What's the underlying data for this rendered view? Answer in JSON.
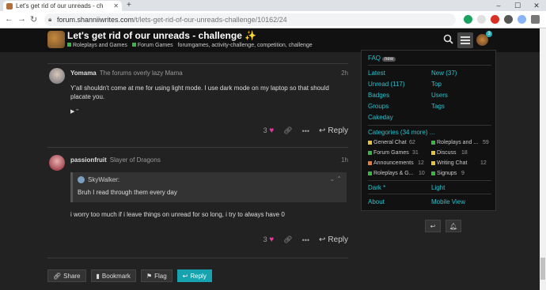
{
  "browser": {
    "tab_title": "Let's get rid of our unreads - ch",
    "url_host": "forum.shanniiwrites.com",
    "url_path": "/t/lets-get-rid-of-our-unreads-challenge/10162/24",
    "win_min": "–",
    "win_max": "☐",
    "win_close": "✕"
  },
  "header": {
    "title": "Let's get rid of our unreads - challenge",
    "title_emoji": "✨",
    "category": "Roleplays and Games",
    "subcategory": "Forum Games",
    "tags": "forumgames, activity-challenge, competition, challenge",
    "notif_count": "3",
    "colors": {
      "category": "#3ab54a",
      "subcategory": "#3ab54a"
    }
  },
  "posts": [
    {
      "username": "Yomama",
      "user_title": "The forums overly lazy Mama",
      "time": "2h",
      "body": "Y'all shouldn't come at me for using light mode. I use dark mode on my laptop so that should placate you.",
      "details_label": "▶ \"",
      "likes": "3",
      "reply_label": "Reply"
    },
    {
      "username": "passionfruit",
      "user_title": "Slayer of Dragons",
      "time": "1h",
      "quote_author": "SkyWalker:",
      "quote_text": "Bruh I read through them every day",
      "body": "i worry too much if i leave things on unread for so long, i try to always have 0",
      "likes": "3",
      "reply_label": "Reply"
    }
  ],
  "bottom_bar": {
    "share": "Share",
    "bookmark": "Bookmark",
    "flag": "Flag",
    "reply": "Reply"
  },
  "menu": {
    "faq": "FAQ",
    "new_badge": "new",
    "latest": "Latest",
    "new_count": "New (37)",
    "unread": "Unread (117)",
    "top": "Top",
    "badges": "Badges",
    "users": "Users",
    "groups": "Groups",
    "tags": "Tags",
    "cakeday": "Cakeday",
    "categories_header": "Categories (34 more) ...",
    "categories": [
      {
        "name": "General Chat",
        "count": "62",
        "color": "#e8c23b"
      },
      {
        "name": "Roleplays and ...",
        "count": "59",
        "color": "#3ab54a"
      },
      {
        "name": "Forum Games",
        "count": "31",
        "color": "#3ab54a"
      },
      {
        "name": "Discuss",
        "count": "18",
        "color": "#e8c23b"
      },
      {
        "name": "Announcements",
        "count": "12",
        "color": "#e87a3b"
      },
      {
        "name": "Writing Chat",
        "count": "12",
        "color": "#e8c23b"
      },
      {
        "name": "Roleplays & G...",
        "count": "10",
        "color": "#3ab54a"
      },
      {
        "name": "Signups",
        "count": "9",
        "color": "#3ab54a"
      }
    ],
    "dark": "Dark *",
    "light": "Light",
    "about": "About",
    "mobile_view": "Mobile View"
  },
  "icons": {
    "search": "search-icon",
    "menu": "hamburger-icon",
    "link": "link-icon",
    "more": "more-icon",
    "reply": "reply-icon"
  }
}
